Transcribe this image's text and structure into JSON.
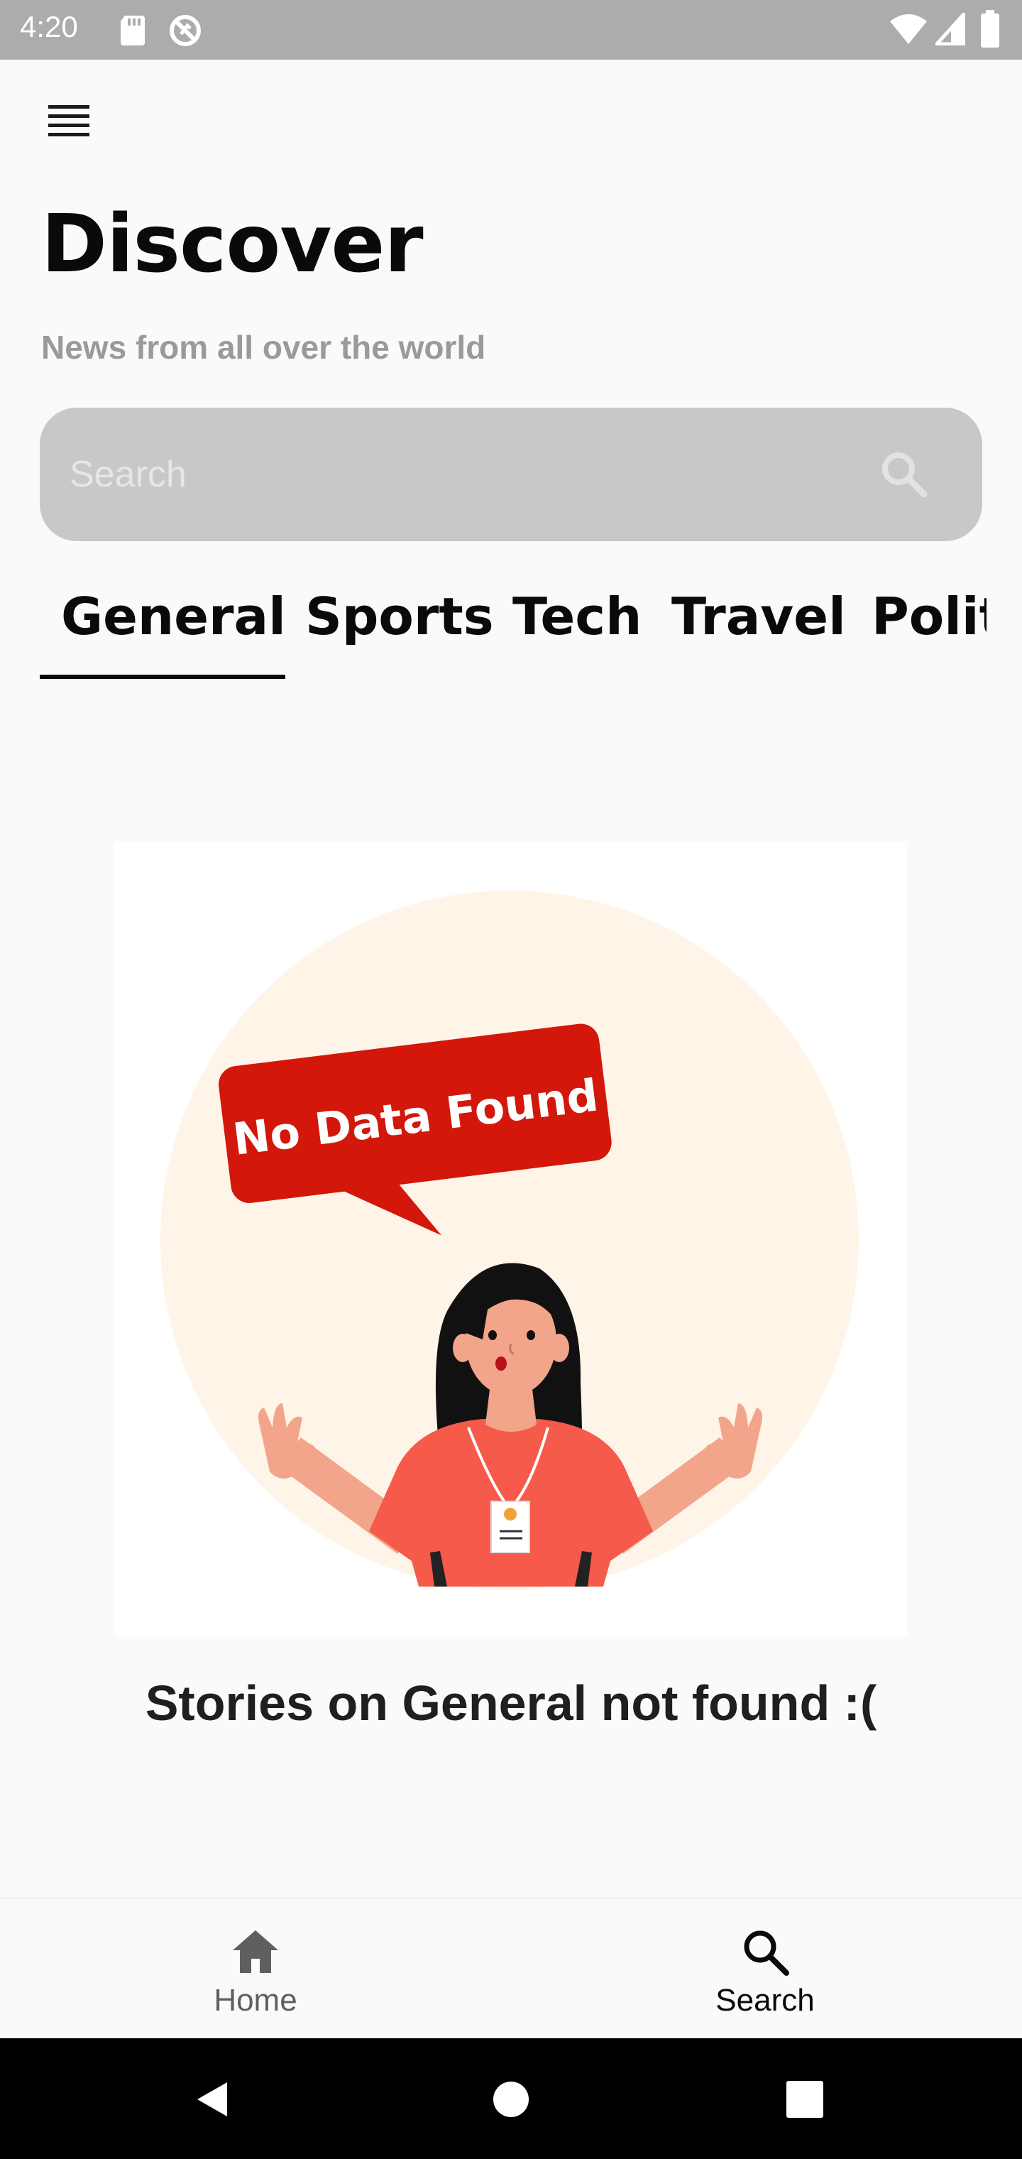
{
  "status_bar": {
    "time": "4:20",
    "left_icons": [
      "sd-card-icon",
      "do-not-disturb-icon"
    ],
    "right_icons": [
      "wifi-icon",
      "cell-signal-icon",
      "battery-icon"
    ]
  },
  "header": {
    "menu_icon": "hamburger-menu-icon",
    "title": "Discover",
    "subtitle": "News from all over the world"
  },
  "search": {
    "placeholder": "Search",
    "value": "",
    "icon": "search-icon"
  },
  "tabs": [
    {
      "label": "General",
      "selected": true
    },
    {
      "label": "Sports",
      "selected": false
    },
    {
      "label": "Tech",
      "selected": false
    },
    {
      "label": "Travel",
      "selected": false
    },
    {
      "label": "Polit",
      "selected": false
    }
  ],
  "empty_state": {
    "illustration": "no-data-illustration",
    "bubble_text": "No Data Found",
    "message": "Stories on General not found :("
  },
  "bottom_nav": {
    "items": [
      {
        "label": "Home",
        "icon": "home-icon",
        "active": false
      },
      {
        "label": "Search",
        "icon": "search-icon",
        "active": true
      }
    ]
  },
  "system_nav": [
    "back-icon",
    "home-circle-icon",
    "recents-icon"
  ],
  "colors": {
    "status_bar": "#acacac",
    "background": "#fafafa",
    "search_box": "#c8c8c8",
    "bubble_red": "#d3170a",
    "circle_bg": "#fff4e8",
    "shirt": "#f55a4a",
    "skin": "#f2a58a",
    "text_primary": "#0a0a0a",
    "text_secondary": "#9a9a9a",
    "inactive_nav": "#5f5f5f"
  }
}
